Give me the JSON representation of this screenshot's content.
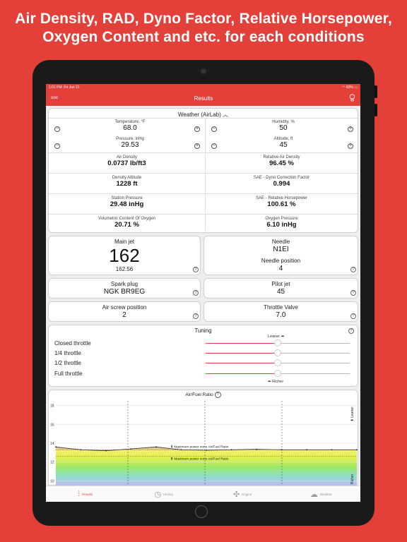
{
  "headline": {
    "line1": "Air Density, RAD, Dyno Factor, Relative Horsepower,",
    "line2": "Oxygen Content and etc. for each conditions"
  },
  "status_bar": {
    "time": "1:01 PM",
    "date": "Fri Jun 21",
    "battery": "83%"
  },
  "navbar": {
    "left": "ooo",
    "title": "Results"
  },
  "weather": {
    "title": "Weather (AirLab)",
    "temperature": {
      "label": "Temperature, °F",
      "value": "68.0"
    },
    "humidity": {
      "label": "Humidity, %",
      "value": "50"
    },
    "pressure": {
      "label": "Pressure, inHg",
      "value": "29.53"
    },
    "altitude": {
      "label": "Altitude, ft",
      "value": "45"
    },
    "air_density": {
      "label": "Air Density",
      "value": "0.0737 lb/ft3"
    },
    "relative_air_density": {
      "label": "Relative Air Density",
      "value": "96.45 %"
    },
    "density_altitude": {
      "label": "Density Altitude",
      "value": "1228 ft"
    },
    "dyno_factor": {
      "label": "SAE - Dyno Correction Factor",
      "value": "0.994"
    },
    "station_pressure": {
      "label": "Station Pressure",
      "value": "29.48 inHg"
    },
    "relative_hp": {
      "label": "SAE - Relative Horsepower",
      "value": "100.61 %"
    },
    "oxygen_content": {
      "label": "Volumetric Content Of Oxygen",
      "value": "20.71 %"
    },
    "oxygen_pressure": {
      "label": "Oxygen Pressure",
      "value": "6.10 inHg"
    }
  },
  "main_jet": {
    "label": "Main jet",
    "value": "162",
    "sub": "162.56"
  },
  "needle": {
    "label": "Needle",
    "value": "N1EI",
    "pos_label": "Needle position",
    "pos_value": "4"
  },
  "spark_plug": {
    "label": "Spark plug",
    "value": "NGK BR9EG"
  },
  "pilot_jet": {
    "label": "Pilot jet",
    "value": "45"
  },
  "air_screw": {
    "label": "Air screw position",
    "value": "2"
  },
  "throttle_valve": {
    "label": "Throttle Valve",
    "value": "7.0"
  },
  "tuning": {
    "title": "Tuning",
    "leaner": "Leaner ➡",
    "richer": "⬅ Richer",
    "rows": [
      {
        "label": "Closed throttle",
        "level": 0.5
      },
      {
        "label": "1/4 throttle",
        "level": 0.5
      },
      {
        "label": "1/2 throttle",
        "level": 0.5
      },
      {
        "label": "Full throttle",
        "level": 0.5
      }
    ]
  },
  "afr_chart": {
    "title": "Air/Fuel Ratio",
    "leaner": "Leaner",
    "richer": "Richer",
    "max_power_up": "⬇ Maximum power zone Air/Fuel Ratio",
    "max_power_down": "⬆ Maximum power zone Air/Fuel Ratio"
  },
  "chart_data": {
    "type": "area",
    "title": "Air/Fuel Ratio",
    "ylim": [
      9.5,
      18.5
    ],
    "yticks": [
      "18",
      "16",
      "14",
      "12",
      "10"
    ],
    "x": [
      0,
      1,
      2,
      3,
      4,
      5,
      6,
      7,
      8,
      9,
      10,
      11,
      12
    ],
    "series": [
      {
        "values": [
          13.6,
          13.3,
          13.2,
          13.4,
          13.6,
          13.3,
          13.25,
          13.3,
          13.35,
          13.3,
          13.3,
          13.3,
          13.3
        ]
      }
    ],
    "max_power_zone": [
      12.6,
      13.3
    ]
  },
  "tabs": [
    {
      "label": "Results",
      "icon": "results-icon"
    },
    {
      "label": "History",
      "icon": "history-icon"
    },
    {
      "label": "Engine",
      "icon": "engine-icon"
    },
    {
      "label": "Weather",
      "icon": "weather-icon"
    }
  ],
  "colors": {
    "accent": "#e4403a"
  }
}
